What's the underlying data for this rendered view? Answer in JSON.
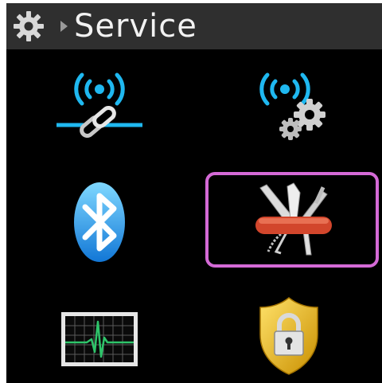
{
  "header": {
    "icon": "gear-icon",
    "separator_icon": "chevron-right-icon",
    "title": "Service"
  },
  "grid": {
    "selected_index": 3,
    "selection_color": "#d46ad6",
    "items": [
      {
        "icon": "wireless-link-icon"
      },
      {
        "icon": "wireless-settings-icon"
      },
      {
        "icon": "bluetooth-icon"
      },
      {
        "icon": "swiss-army-knife-icon"
      },
      {
        "icon": "ecg-monitor-icon"
      },
      {
        "icon": "security-lock-icon"
      }
    ]
  },
  "colors": {
    "title_bar": "#2f2f2f",
    "accent_blue": "#1fb8f0",
    "knife_red": "#d2462c",
    "shield_gold": "#e8b80c"
  }
}
